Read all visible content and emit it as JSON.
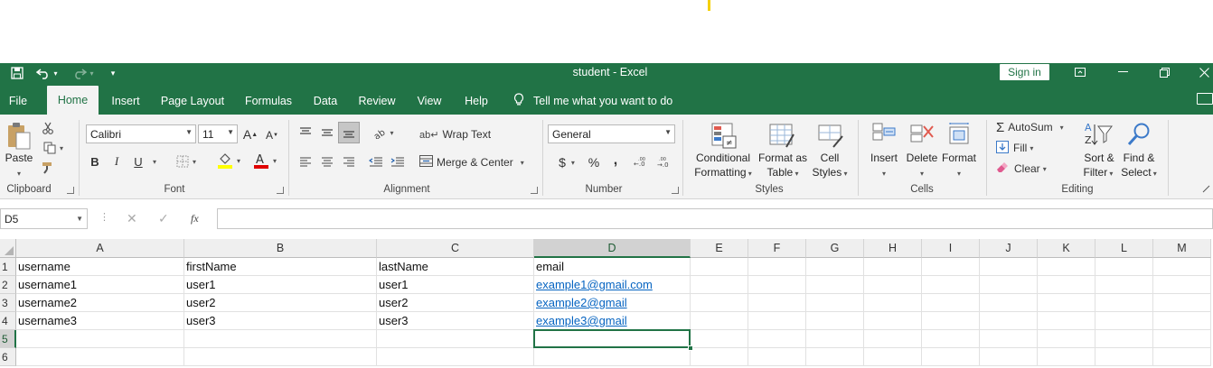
{
  "window": {
    "title": "student  -  Excel",
    "sign_in": "Sign in"
  },
  "tabs": [
    {
      "label": "File"
    },
    {
      "label": "Home",
      "active": true
    },
    {
      "label": "Insert"
    },
    {
      "label": "Page Layout"
    },
    {
      "label": "Formulas"
    },
    {
      "label": "Data"
    },
    {
      "label": "Review"
    },
    {
      "label": "View"
    },
    {
      "label": "Help"
    }
  ],
  "tell_me": "Tell me what you want to do",
  "ribbon": {
    "clipboard": {
      "group": "Clipboard",
      "paste": "Paste"
    },
    "font": {
      "group": "Font",
      "name": "Calibri",
      "size": "11",
      "bold": "B",
      "italic": "I",
      "underline": "U"
    },
    "alignment": {
      "group": "Alignment",
      "wrap_text": "Wrap Text",
      "merge_center": "Merge & Center"
    },
    "number": {
      "group": "Number",
      "format": "General",
      "currency": "$",
      "percent": "%",
      "comma": ","
    },
    "styles": {
      "group": "Styles",
      "conditional_1": "Conditional",
      "conditional_2": "Formatting",
      "format_table_1": "Format as",
      "format_table_2": "Table",
      "cell_styles_1": "Cell",
      "cell_styles_2": "Styles"
    },
    "cells": {
      "group": "Cells",
      "insert": "Insert",
      "delete": "Delete",
      "format": "Format"
    },
    "editing": {
      "group": "Editing",
      "autosum": "AutoSum",
      "fill": "Fill",
      "clear": "Clear",
      "sort_1": "Sort &",
      "sort_2": "Filter",
      "find_1": "Find &",
      "find_2": "Select"
    }
  },
  "formula_bar": {
    "name_box": "D5",
    "fx": "fx",
    "formula": ""
  },
  "sheet": {
    "columns": [
      "A",
      "B",
      "C",
      "D",
      "E",
      "F",
      "G",
      "H",
      "I",
      "J",
      "K",
      "L",
      "M"
    ],
    "rows": [
      "1",
      "2",
      "3",
      "4",
      "5",
      "6"
    ],
    "cells": [
      [
        "username",
        "firstName",
        "lastName",
        "email"
      ],
      [
        "username1",
        "user1",
        "user1",
        "example1@gmail.com"
      ],
      [
        "username2",
        "user2",
        "user2",
        "example2@gmail"
      ],
      [
        "username3",
        "user3",
        "user3",
        "example3@gmail"
      ]
    ],
    "active_cell": "D5"
  },
  "colors": {
    "excel_green": "#217346",
    "link_blue": "#0563c1"
  }
}
